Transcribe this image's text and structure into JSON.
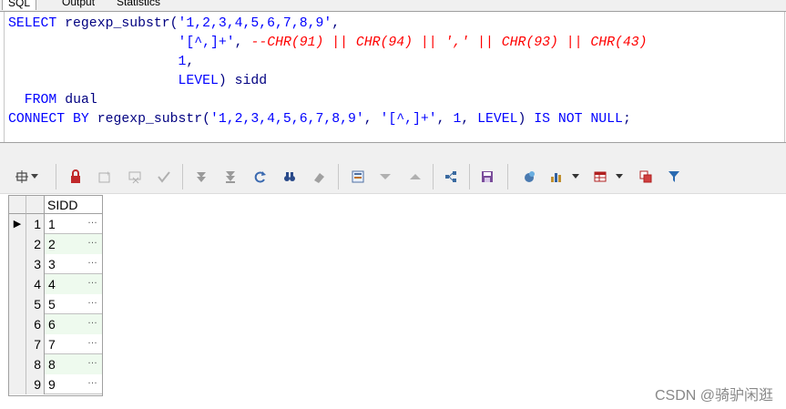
{
  "tabs": [
    {
      "label": "SQL",
      "active": true
    },
    {
      "label": "Output",
      "active": false
    },
    {
      "label": "Statistics",
      "active": false
    }
  ],
  "editor": {
    "line1": {
      "kw": "SELECT",
      "fn": "regexp_substr(",
      "str": "'1,2,3,4,5,6,7,8,9'",
      "tail": ","
    },
    "line2": {
      "str": "'[^,]+'",
      "comma": ",",
      "comment": "--CHR(91) || CHR(94) || ',' || CHR(93) || CHR(43)"
    },
    "line3": {
      "num": "1",
      "tail": ","
    },
    "line4": {
      "kw": "LEVEL",
      "tail": ") sidd"
    },
    "line5": {
      "kw": "FROM",
      "tbl": "dual"
    },
    "line6": {
      "kw1": "CONNECT BY",
      "fn": "regexp_substr(",
      "str1": "'1,2,3,4,5,6,7,8,9'",
      "c1": ", ",
      "str2": "'[^,]+'",
      "c2": ", ",
      "num": "1",
      "c3": ", ",
      "kw2": "LEVEL",
      "c4": ") ",
      "kw3": "IS NOT NULL",
      "end": ";"
    }
  },
  "toolbar": {
    "icons": [
      "query-options-icon",
      "lock-icon",
      "add-record-icon",
      "delete-record-icon",
      "post-changes-icon",
      "first-record-icon",
      "last-record-icon",
      "refresh-icon",
      "find-icon",
      "clear-icon",
      "single-record-view-icon",
      "previous-icon",
      "next-icon",
      "query-by-example-icon",
      "save-icon",
      "export-icon",
      "chart-icon",
      "grid-view-icon",
      "compare-icon",
      "filter-icon"
    ]
  },
  "grid": {
    "column": "SIDD",
    "row_numbers": [
      "1",
      "2",
      "3",
      "4",
      "5",
      "6",
      "7",
      "8",
      "9"
    ],
    "values": [
      "1",
      "2",
      "3",
      "4",
      "5",
      "6",
      "7",
      "8",
      "9"
    ],
    "current_row_marker": "▶",
    "cell_button": "…"
  },
  "watermark": "CSDN @骑驴闲逛"
}
